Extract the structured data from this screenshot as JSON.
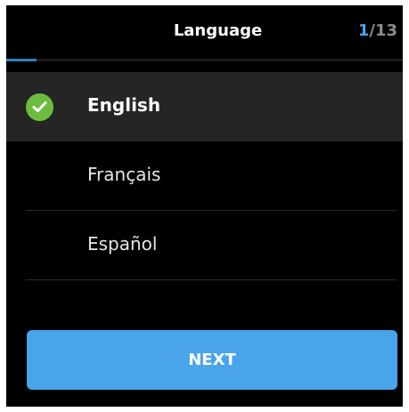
{
  "header": {
    "title": "Language",
    "step_current": "1",
    "step_total": "/13"
  },
  "progress": {
    "current_step": 1,
    "total_steps": 13
  },
  "languages": [
    {
      "label": "English",
      "selected": true
    },
    {
      "label": "Français",
      "selected": false
    },
    {
      "label": "Español",
      "selected": false
    }
  ],
  "actions": {
    "next_label": "NEXT"
  },
  "colors": {
    "accent": "#49a4ea",
    "check": "#6bbc3f",
    "background": "#000000",
    "selected_row": "#252525"
  }
}
